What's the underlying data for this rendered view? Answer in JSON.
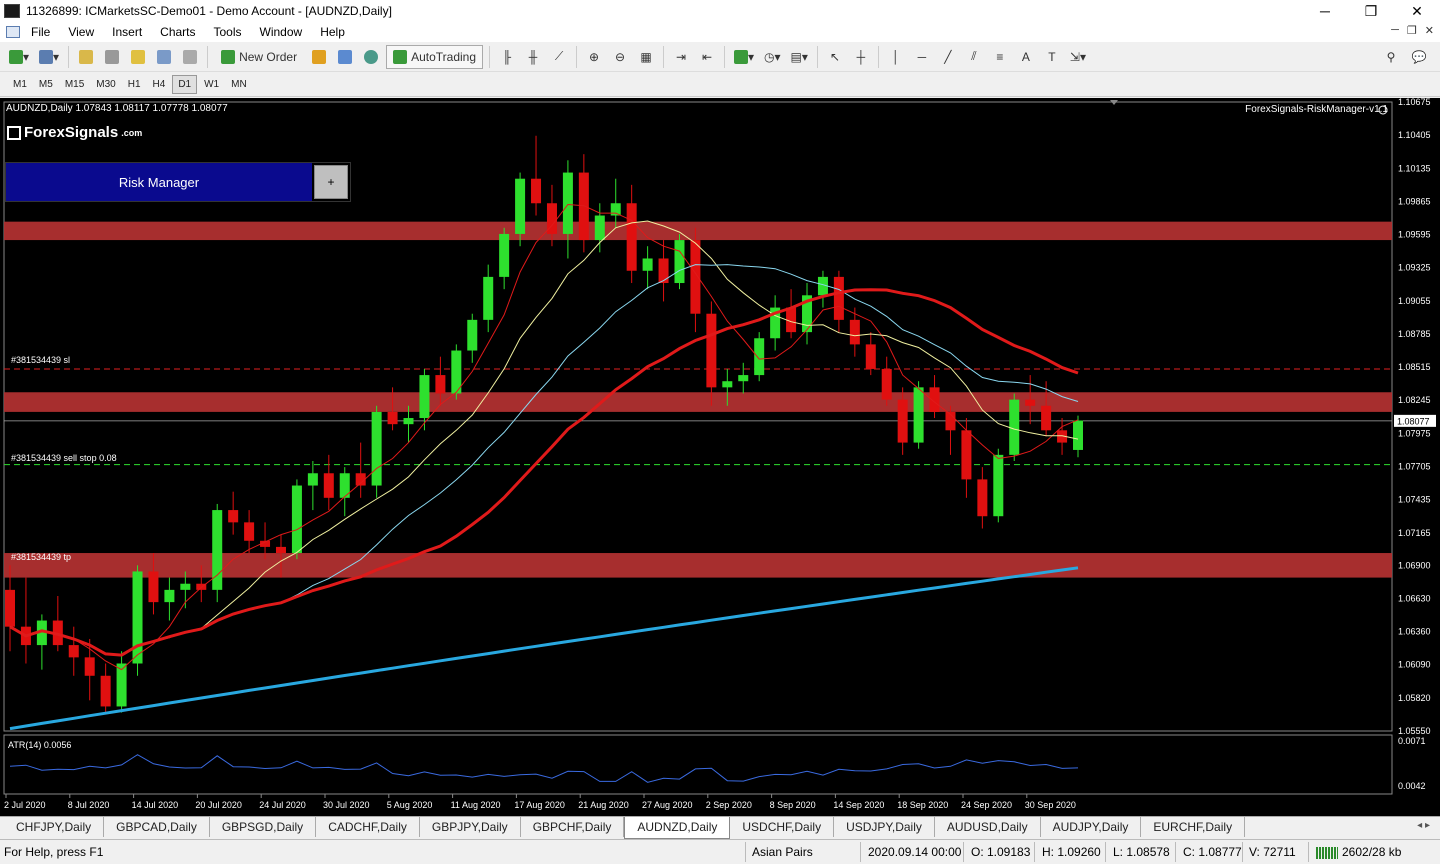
{
  "window": {
    "title": "11326899: ICMarketsSC-Demo01 - Demo Account - [AUDNZD,Daily]",
    "min": "─",
    "max": "❐",
    "close": "✕"
  },
  "menu": [
    "File",
    "View",
    "Insert",
    "Charts",
    "Tools",
    "Window",
    "Help"
  ],
  "toolbar": {
    "new_order": "New Order",
    "autotrading": "AutoTrading"
  },
  "timeframes": [
    "M1",
    "M5",
    "M15",
    "M30",
    "H1",
    "H4",
    "D1",
    "W1",
    "MN"
  ],
  "active_timeframe": "D1",
  "chart": {
    "symbol_info": "AUDNZD,Daily  1.07843 1.08117 1.07778 1.08077",
    "logo": "ForexSignals",
    "logo_suffix": ".com",
    "risk_manager_label": "Risk Manager",
    "risk_manager_plus": "+",
    "ea_label": "ForexSignals-RiskManager-v1.1",
    "sl_label": "#381534439 sl",
    "sell_stop_label": "#381534439 sell stop 0.08",
    "tp_label": "#381534439 tp",
    "current_price": "1.08077",
    "atr_label": "ATR(14) 0.0056",
    "atr_scale": [
      "0.0071",
      "0.0042"
    ]
  },
  "chart_data": {
    "type": "candlestick",
    "price_scale": [
      "1.10675",
      "1.10405",
      "1.10135",
      "1.09865",
      "1.09595",
      "1.09325",
      "1.09055",
      "1.08785",
      "1.08515",
      "1.08245",
      "1.07975",
      "1.07705",
      "1.07435",
      "1.07165",
      "1.06900",
      "1.06630",
      "1.06360",
      "1.06090",
      "1.05820",
      "1.05550"
    ],
    "ylim": [
      1.0555,
      1.10675
    ],
    "date_labels": [
      "2 Jul 2020",
      "8 Jul 2020",
      "14 Jul 2020",
      "20 Jul 2020",
      "24 Jul 2020",
      "30 Jul 2020",
      "5 Aug 2020",
      "11 Aug 2020",
      "17 Aug 2020",
      "21 Aug 2020",
      "27 Aug 2020",
      "2 Sep 2020",
      "8 Sep 2020",
      "14 Sep 2020",
      "18 Sep 2020",
      "24 Sep 2020",
      "30 Sep 2020"
    ],
    "sl_level": 1.085,
    "sell_stop_level": 1.0772,
    "current_price": 1.08077,
    "zones": [
      [
        1.0955,
        1.097
      ],
      [
        1.0815,
        1.0831
      ],
      [
        1.068,
        1.07
      ]
    ],
    "candles": [
      [
        1.067,
        1.069,
        1.062,
        1.064
      ],
      [
        1.064,
        1.068,
        1.061,
        1.0625
      ],
      [
        1.0625,
        1.065,
        1.0605,
        1.0645
      ],
      [
        1.0645,
        1.0665,
        1.062,
        1.0625
      ],
      [
        1.0625,
        1.064,
        1.06,
        1.0615
      ],
      [
        1.0615,
        1.063,
        1.058,
        1.06
      ],
      [
        1.06,
        1.061,
        1.057,
        1.0575
      ],
      [
        1.0575,
        1.062,
        1.057,
        1.061
      ],
      [
        1.061,
        1.069,
        1.06,
        1.0685
      ],
      [
        1.0685,
        1.07,
        1.065,
        1.066
      ],
      [
        1.066,
        1.068,
        1.0645,
        1.067
      ],
      [
        1.067,
        1.0685,
        1.0655,
        1.0675
      ],
      [
        1.0675,
        1.069,
        1.066,
        1.067
      ],
      [
        1.067,
        1.074,
        1.066,
        1.0735
      ],
      [
        1.0735,
        1.075,
        1.0715,
        1.0725
      ],
      [
        1.0725,
        1.0735,
        1.07,
        1.071
      ],
      [
        1.071,
        1.0725,
        1.0695,
        1.0705
      ],
      [
        1.0705,
        1.0715,
        1.068,
        1.07
      ],
      [
        1.07,
        1.076,
        1.0695,
        1.0755
      ],
      [
        1.0755,
        1.0775,
        1.0735,
        1.0765
      ],
      [
        1.0765,
        1.078,
        1.0735,
        1.0745
      ],
      [
        1.0745,
        1.077,
        1.073,
        1.0765
      ],
      [
        1.0765,
        1.079,
        1.0745,
        1.0755
      ],
      [
        1.0755,
        1.082,
        1.0745,
        1.0815
      ],
      [
        1.0815,
        1.0835,
        1.08,
        1.0805
      ],
      [
        1.0805,
        1.082,
        1.079,
        1.081
      ],
      [
        1.081,
        1.085,
        1.08,
        1.0845
      ],
      [
        1.0845,
        1.086,
        1.082,
        1.083
      ],
      [
        1.083,
        1.087,
        1.0825,
        1.0865
      ],
      [
        1.0865,
        1.0895,
        1.0855,
        1.089
      ],
      [
        1.089,
        1.0935,
        1.088,
        1.0925
      ],
      [
        1.0925,
        1.0965,
        1.0915,
        1.096
      ],
      [
        1.096,
        1.101,
        1.095,
        1.1005
      ],
      [
        1.1005,
        1.104,
        1.0975,
        1.0985
      ],
      [
        1.0985,
        1.1,
        1.095,
        1.096
      ],
      [
        1.096,
        1.102,
        1.094,
        1.101
      ],
      [
        1.101,
        1.1025,
        1.0945,
        1.0955
      ],
      [
        1.0955,
        1.0985,
        1.0945,
        1.0975
      ],
      [
        1.0975,
        1.1005,
        1.0965,
        1.0985
      ],
      [
        1.0985,
        1.1,
        1.092,
        1.093
      ],
      [
        1.093,
        1.095,
        1.0915,
        1.094
      ],
      [
        1.094,
        1.0955,
        1.0905,
        1.092
      ],
      [
        1.092,
        1.096,
        1.0915,
        1.0955
      ],
      [
        1.0955,
        1.0965,
        1.088,
        1.0895
      ],
      [
        1.0895,
        1.0905,
        1.082,
        1.0835
      ],
      [
        1.0835,
        1.085,
        1.082,
        1.084
      ],
      [
        1.084,
        1.0855,
        1.083,
        1.0845
      ],
      [
        1.0845,
        1.088,
        1.084,
        1.0875
      ],
      [
        1.0875,
        1.091,
        1.0865,
        1.09
      ],
      [
        1.09,
        1.0915,
        1.0875,
        1.088
      ],
      [
        1.088,
        1.092,
        1.087,
        1.091
      ],
      [
        1.091,
        1.093,
        1.09,
        1.0925
      ],
      [
        1.0925,
        1.093,
        1.088,
        1.089
      ],
      [
        1.089,
        1.09,
        1.086,
        1.087
      ],
      [
        1.087,
        1.088,
        1.0845,
        1.085
      ],
      [
        1.085,
        1.086,
        1.082,
        1.0825
      ],
      [
        1.0825,
        1.0835,
        1.078,
        1.079
      ],
      [
        1.079,
        1.084,
        1.0785,
        1.0835
      ],
      [
        1.0835,
        1.0845,
        1.081,
        1.0815
      ],
      [
        1.0815,
        1.082,
        1.078,
        1.08
      ],
      [
        1.08,
        1.081,
        1.0745,
        1.076
      ],
      [
        1.076,
        1.077,
        1.072,
        1.073
      ],
      [
        1.073,
        1.0785,
        1.0725,
        1.078
      ],
      [
        1.078,
        1.083,
        1.0775,
        1.0825
      ],
      [
        1.0825,
        1.0845,
        1.0805,
        1.082
      ],
      [
        1.082,
        1.084,
        1.0795,
        1.08
      ],
      [
        1.08,
        1.081,
        1.078,
        1.079
      ],
      [
        1.0784,
        1.0812,
        1.0778,
        1.0808
      ]
    ]
  },
  "symbol_tabs": [
    "CHFJPY,Daily",
    "GBPCAD,Daily",
    "GBPSGD,Daily",
    "CADCHF,Daily",
    "GBPJPY,Daily",
    "GBPCHF,Daily",
    "AUDNZD,Daily",
    "USDCHF,Daily",
    "USDJPY,Daily",
    "AUDUSD,Daily",
    "AUDJPY,Daily",
    "EURCHF,Daily"
  ],
  "active_tab": "AUDNZD,Daily",
  "status": {
    "help": "For Help, press F1",
    "profile": "Asian Pairs",
    "datetime": "2020.09.14 00:00",
    "open": "O: 1.09183",
    "high": "H: 1.09260",
    "low": "L: 1.08578",
    "close": "C: 1.08777",
    "volume": "V: 72711",
    "traffic": "2602/28 kb"
  },
  "colors": {
    "bull": "#2ee02e",
    "bear": "#e01010",
    "zone": "#b03030",
    "ma_cyan": "#29a8e0",
    "ma_red": "#e01a1a",
    "risk_blue": "#0a0a8e"
  }
}
